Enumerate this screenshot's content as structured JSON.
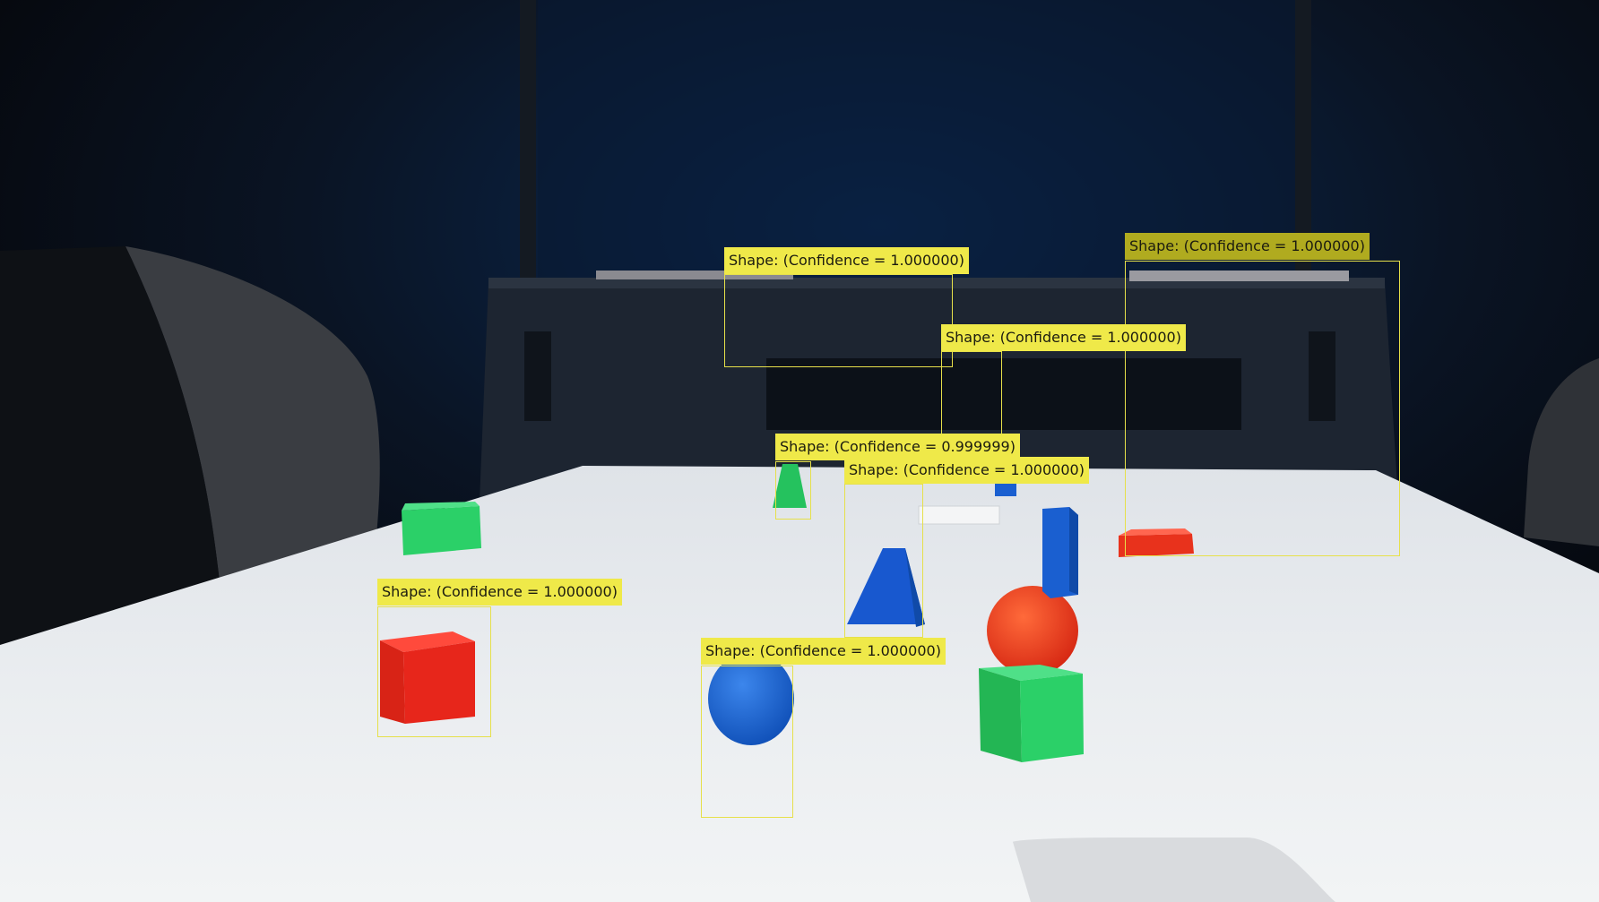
{
  "scene": {
    "objects": [
      {
        "shape": "cube",
        "color": "green"
      },
      {
        "shape": "cube",
        "color": "red"
      },
      {
        "shape": "pyramid",
        "color": "green"
      },
      {
        "shape": "pyramid",
        "color": "blue"
      },
      {
        "shape": "sphere",
        "color": "blue"
      },
      {
        "shape": "sphere",
        "color": "red"
      },
      {
        "shape": "cube",
        "color": "green"
      },
      {
        "shape": "cuboid",
        "color": "blue"
      },
      {
        "shape": "cuboid",
        "color": "blue"
      },
      {
        "shape": "slab",
        "color": "red"
      }
    ]
  },
  "detections": [
    {
      "label": "Shape: (Confidence = 1.000000)",
      "confidence": 1.0
    },
    {
      "label": "Shape: (Confidence = 1.000000)",
      "confidence": 1.0
    },
    {
      "label": "Shape: (Confidence = 1.000000)",
      "confidence": 1.0
    },
    {
      "label": "Shape: (Confidence = 0.999999)",
      "confidence": 0.999999
    },
    {
      "label": "Shape: (Confidence = 1.000000)",
      "confidence": 1.0
    },
    {
      "label": "Shape: (Confidence = 1.000000)",
      "confidence": 1.0
    },
    {
      "label": "Shape: (Confidence = 1.000000)",
      "confidence": 1.0
    }
  ],
  "colors": {
    "box": "#e6e04a",
    "label": "#efe949",
    "label_dim": "#b0ab1f",
    "table": "#e9ecef",
    "background": "#0e131c",
    "red": "#e5201f",
    "green": "#2ecc65",
    "blue": "#1b5fd1"
  }
}
